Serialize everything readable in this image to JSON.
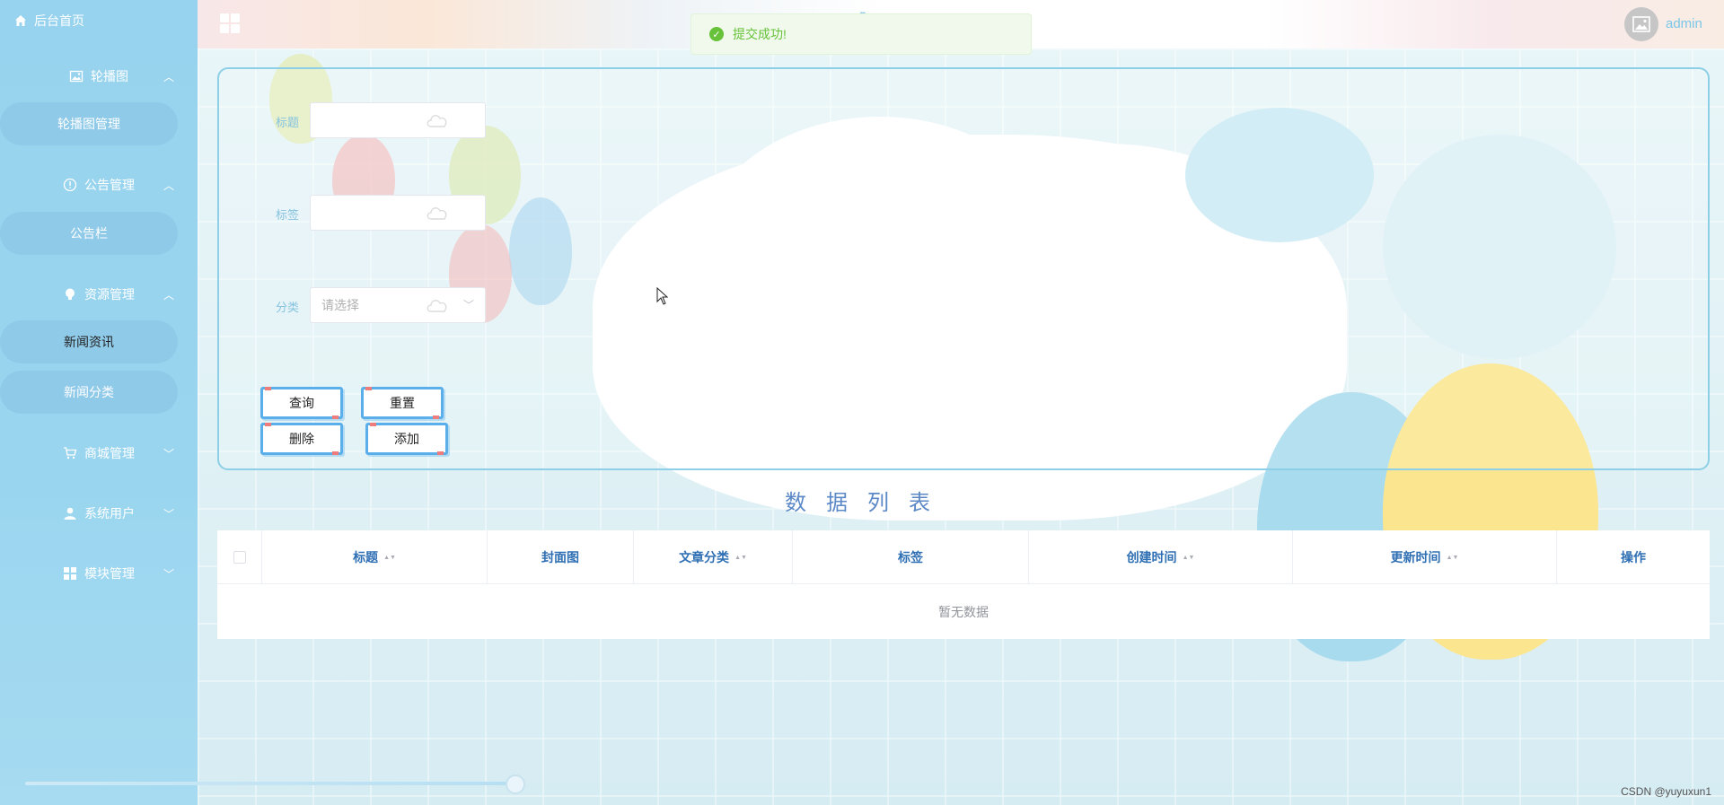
{
  "sidebar": {
    "home": "后台首页",
    "groups": [
      {
        "label": "轮播图",
        "icon": "image-icon",
        "expanded": true,
        "items": [
          "轮播图管理"
        ]
      },
      {
        "label": "公告管理",
        "icon": "info-icon",
        "expanded": true,
        "items": [
          "公告栏"
        ]
      },
      {
        "label": "资源管理",
        "icon": "bulb-icon",
        "expanded": true,
        "items": [
          "新闻资讯",
          "新闻分类"
        ]
      },
      {
        "label": "商城管理",
        "icon": "cart-icon",
        "expanded": false
      },
      {
        "label": "系统用户",
        "icon": "user-icon",
        "expanded": false
      },
      {
        "label": "模块管理",
        "icon": "grid-icon",
        "expanded": false
      }
    ],
    "active_item": "新闻资讯"
  },
  "header": {
    "title": "App",
    "user": "admin"
  },
  "toast": {
    "message": "提交成功!",
    "type": "success"
  },
  "filters": {
    "title_label": "标题",
    "tag_label": "标签",
    "category_label": "分类",
    "category_placeholder": "请选择"
  },
  "buttons": {
    "query": "查询",
    "reset": "重置",
    "delete": "删除",
    "add": "添加"
  },
  "list_title": "数据列表",
  "table": {
    "columns": [
      {
        "label": "标题",
        "sortable": true
      },
      {
        "label": "封面图",
        "sortable": false
      },
      {
        "label": "文章分类",
        "sortable": true
      },
      {
        "label": "标签",
        "sortable": false
      },
      {
        "label": "创建时间",
        "sortable": true
      },
      {
        "label": "更新时间",
        "sortable": true
      },
      {
        "label": "操作",
        "sortable": false
      }
    ],
    "empty_text": "暂无数据"
  },
  "watermark": "CSDN @yuyuxun1",
  "colors": {
    "sidebar_bg": "#97d3ee",
    "accent": "#5aaeea",
    "header_text": "#2f6fb3",
    "success": "#67c23a"
  }
}
